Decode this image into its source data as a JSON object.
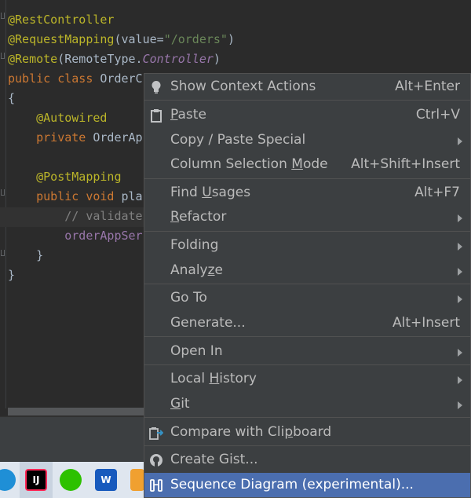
{
  "editor": {
    "lines": [
      {
        "segments": [
          {
            "t": "@RestController",
            "c": "ann"
          }
        ]
      },
      {
        "segments": [
          {
            "t": "@RequestMapping",
            "c": "ann"
          },
          {
            "t": "(value=",
            "c": ""
          },
          {
            "t": "\"/orders\"",
            "c": "str"
          },
          {
            "t": ")",
            "c": ""
          }
        ]
      },
      {
        "segments": [
          {
            "t": "@Remote",
            "c": "ann"
          },
          {
            "t": "(RemoteType.",
            "c": ""
          },
          {
            "t": "Controller",
            "c": "it"
          },
          {
            "t": ")",
            "c": ""
          }
        ]
      },
      {
        "segments": [
          {
            "t": "public class ",
            "c": "kw"
          },
          {
            "t": "OrderC",
            "c": ""
          }
        ]
      },
      {
        "segments": [
          {
            "t": "{",
            "c": ""
          }
        ]
      },
      {
        "segments": [
          {
            "t": "    @Autowired",
            "c": "ann"
          }
        ]
      },
      {
        "segments": [
          {
            "t": "    private ",
            "c": "kw"
          },
          {
            "t": "OrderAp",
            "c": ""
          }
        ]
      },
      {
        "segments": [
          {
            "t": "",
            "c": ""
          }
        ]
      },
      {
        "segments": [
          {
            "t": "    @PostMapping",
            "c": "ann"
          }
        ]
      },
      {
        "segments": [
          {
            "t": "    public void ",
            "c": "kw"
          },
          {
            "t": "pla",
            "c": ""
          }
        ]
      },
      {
        "segments": [
          {
            "t": "        // validate",
            "c": "cm"
          }
        ]
      },
      {
        "segments": [
          {
            "t": "        orderAppSer",
            "c": "fld"
          }
        ]
      },
      {
        "segments": [
          {
            "t": "    }",
            "c": ""
          }
        ]
      },
      {
        "segments": [
          {
            "t": "}",
            "c": ""
          }
        ]
      }
    ]
  },
  "taskbar": {
    "apps": [
      {
        "name": "edge-icon",
        "label": ""
      },
      {
        "name": "intellij-icon",
        "label": "IJ"
      },
      {
        "name": "wechat-icon",
        "label": ""
      },
      {
        "name": "word-icon",
        "label": "W"
      }
    ]
  },
  "menu": {
    "items": [
      {
        "id": "show-context-actions",
        "icon": "bulb-icon",
        "pre": "Show Context Actions",
        "u": "",
        "post": "",
        "shortcut": "Alt+Enter",
        "submenu": false
      },
      {
        "id": "paste",
        "icon": "clipboard-icon",
        "pre": "",
        "u": "P",
        "post": "aste",
        "shortcut": "Ctrl+V",
        "submenu": false
      },
      {
        "id": "copy-paste-special",
        "icon": "",
        "pre": "Copy / Paste Special",
        "u": "",
        "post": "",
        "shortcut": "",
        "submenu": true
      },
      {
        "id": "column-selection-mode",
        "icon": "",
        "pre": "Column Selection ",
        "u": "M",
        "post": "ode",
        "shortcut": "Alt+Shift+Insert",
        "submenu": false
      },
      {
        "id": "find-usages",
        "icon": "",
        "pre": "Find ",
        "u": "U",
        "post": "sages",
        "shortcut": "Alt+F7",
        "submenu": false
      },
      {
        "id": "refactor",
        "icon": "",
        "pre": "",
        "u": "R",
        "post": "efactor",
        "shortcut": "",
        "submenu": true
      },
      {
        "id": "folding",
        "icon": "",
        "pre": "Folding",
        "u": "",
        "post": "",
        "shortcut": "",
        "submenu": true
      },
      {
        "id": "analyze",
        "icon": "",
        "pre": "Analy",
        "u": "z",
        "post": "e",
        "shortcut": "",
        "submenu": true
      },
      {
        "id": "go-to",
        "icon": "",
        "pre": "Go To",
        "u": "",
        "post": "",
        "shortcut": "",
        "submenu": true
      },
      {
        "id": "generate",
        "icon": "",
        "pre": "Generate...",
        "u": "",
        "post": "",
        "shortcut": "Alt+Insert",
        "submenu": false
      },
      {
        "id": "open-in",
        "icon": "",
        "pre": "Open In",
        "u": "",
        "post": "",
        "shortcut": "",
        "submenu": true
      },
      {
        "id": "local-history",
        "icon": "",
        "pre": "Local ",
        "u": "H",
        "post": "istory",
        "shortcut": "",
        "submenu": true
      },
      {
        "id": "git",
        "icon": "",
        "pre": "",
        "u": "G",
        "post": "it",
        "shortcut": "",
        "submenu": true
      },
      {
        "id": "compare-with-clipboard",
        "icon": "compare-icon",
        "pre": "Compare with Cli",
        "u": "p",
        "post": "board",
        "shortcut": "",
        "submenu": false
      },
      {
        "id": "create-gist",
        "icon": "github-icon",
        "pre": "Create Gist...",
        "u": "",
        "post": "",
        "shortcut": "",
        "submenu": false
      },
      {
        "id": "sequence-diagram",
        "icon": "sequence-diagram-icon",
        "pre": "Sequence Diagram (experimental)...",
        "u": "",
        "post": "",
        "shortcut": "",
        "submenu": false,
        "selected": true
      }
    ]
  },
  "colors": {
    "accent": "#4b6eaf",
    "menu_bg": "#3c3f41",
    "editor_bg": "#2b2b2b"
  }
}
